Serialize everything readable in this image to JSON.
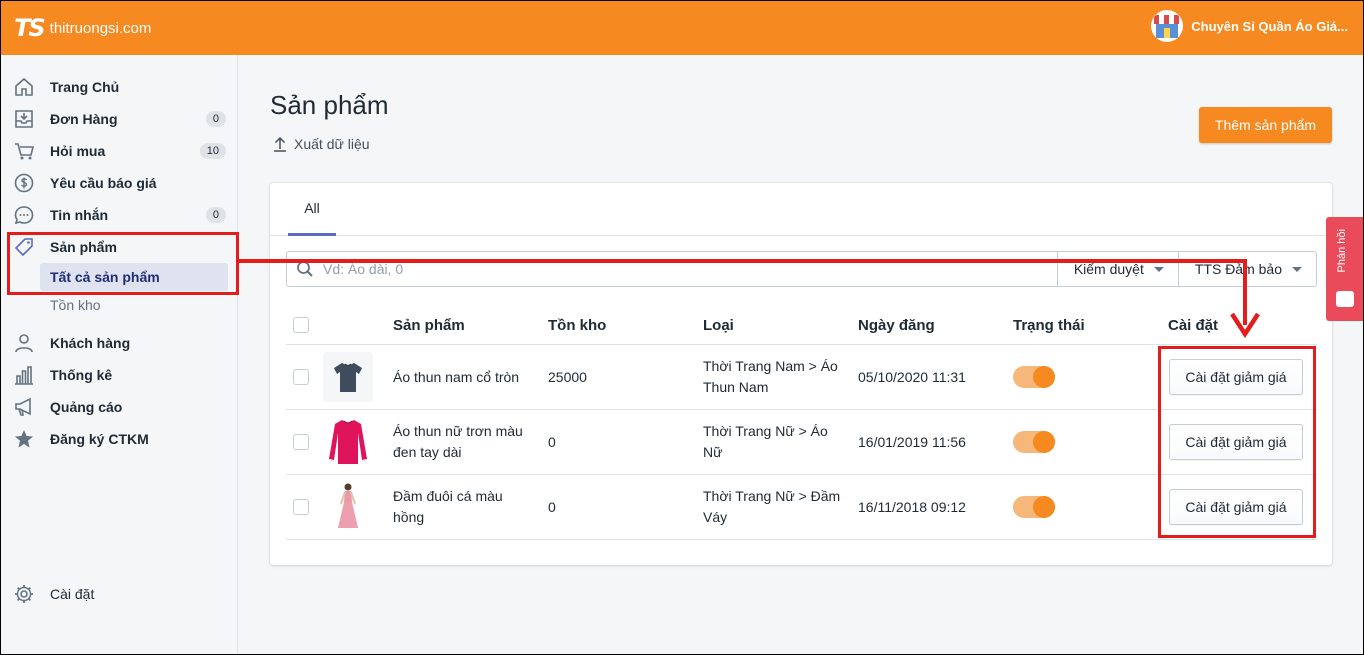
{
  "header": {
    "logo_mark": "TS",
    "logo_text": "thitruongsi.com",
    "shop_name": "Chuyên Sỉ Quần Áo Giá..."
  },
  "sidebar": {
    "items": [
      {
        "label": "Trang Chủ",
        "icon": "home-icon"
      },
      {
        "label": "Đơn Hàng",
        "icon": "inbox-icon",
        "count": "0"
      },
      {
        "label": "Hỏi mua",
        "icon": "cart-icon",
        "count": "10"
      },
      {
        "label": "Yêu cầu báo giá",
        "icon": "dollar-icon"
      },
      {
        "label": "Tin nhắn",
        "icon": "chat-icon",
        "count": "0"
      },
      {
        "label": "Sản phẩm",
        "icon": "tag-icon"
      },
      {
        "label": "Khách hàng",
        "icon": "user-icon"
      },
      {
        "label": "Thống kê",
        "icon": "chart-icon"
      },
      {
        "label": "Quảng cáo",
        "icon": "megaphone-icon"
      },
      {
        "label": "Đăng ký CTKM",
        "icon": "star-icon"
      }
    ],
    "subitems": [
      "Tất cả sản phẩm",
      "Tồn kho"
    ],
    "settings": {
      "label": "Cài đặt",
      "icon": "gear-icon"
    }
  },
  "main": {
    "title": "Sản phẩm",
    "export_label": "Xuất dữ liệu",
    "add_button": "Thêm sản phẩm",
    "tabs": [
      "All"
    ],
    "search": {
      "placeholder": "Vd: Áo dài, 0"
    },
    "filters": [
      "Kiểm duyệt",
      "TTS Đảm bảo"
    ],
    "columns": [
      "Sản phẩm",
      "Tồn kho",
      "Loại",
      "Ngày đăng",
      "Trạng thái",
      "Cài đặt"
    ],
    "rows": [
      {
        "name": "Áo thun nam cổ tròn",
        "stock": "25000",
        "category": "Thời Trang Nam > Áo Thun Nam",
        "date": "05/10/2020 11:31",
        "active": true,
        "action": "Cài đặt giảm giá"
      },
      {
        "name": "Áo thun nữ trơn màu đen tay dài",
        "stock": "0",
        "category": "Thời Trang Nữ > Áo Nữ",
        "date": "16/01/2019 11:56",
        "active": true,
        "action": "Cài đặt giảm giá"
      },
      {
        "name": "Đầm đuôi cá màu hồng",
        "stock": "0",
        "category": "Thời Trang Nữ > Đầm Váy",
        "date": "16/11/2018 09:12",
        "active": true,
        "action": "Cài đặt giảm giá"
      }
    ]
  },
  "feedback": {
    "label": "Phản hồi"
  },
  "colors": {
    "brand": "#f6891f",
    "annotation": "#e31c1c",
    "feedback": "#e94b5a"
  }
}
